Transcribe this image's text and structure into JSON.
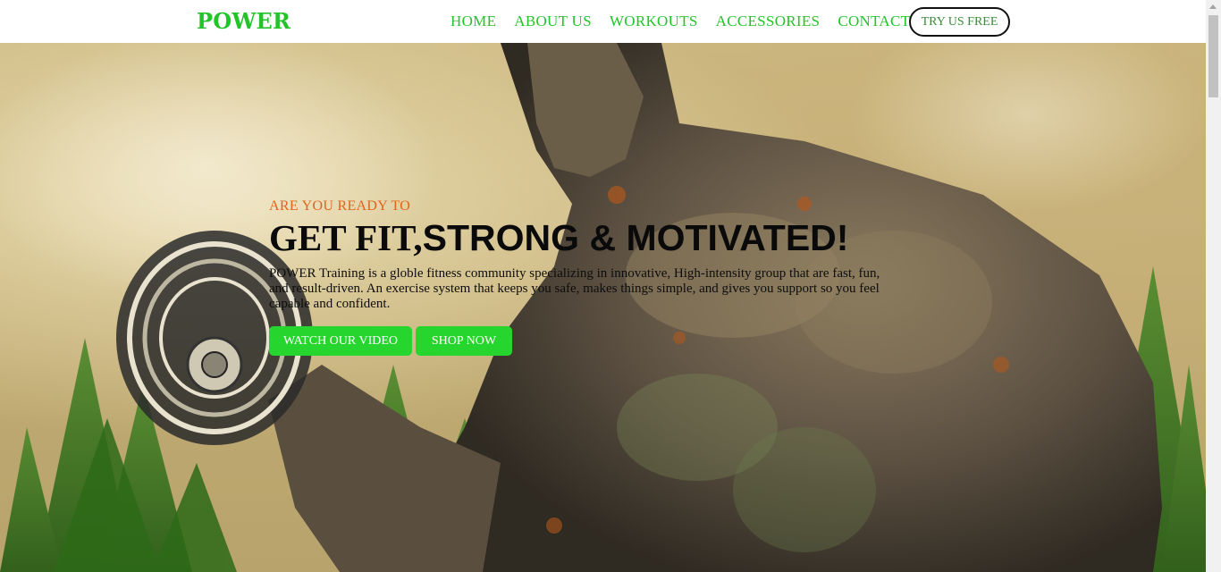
{
  "nav": {
    "brand": "POWER",
    "links": [
      "HOME",
      "ABOUT US",
      "WORKOUTS",
      "ACCESSORIES",
      "CONTACT"
    ],
    "cta": "TRY US FREE"
  },
  "hero": {
    "eyebrow": "ARE YOU READY TO",
    "headline_part1": "GET FIT,",
    "headline_part2": "STRONG & MOTIVATED!",
    "body": "POWER Training is a globle fitness community specializing in innovative, High-intensity group that are fast, fun, and result-driven. An exercise system that keeps you safe, makes things simple, and gives you support so you feel capable and confident.",
    "buttons": {
      "video": "WATCH OUR VIDEO",
      "shop": "SHOP NOW"
    },
    "background_image": "illustration of muscular man curling a dumbbell with forest trees"
  },
  "colors": {
    "brand": "#22c42a",
    "cta_bg": "#26d62e",
    "eyebrow": "#e0651a",
    "headline": "#0a0a0a"
  },
  "icons": {
    "scroll_up": "triangle-up"
  }
}
